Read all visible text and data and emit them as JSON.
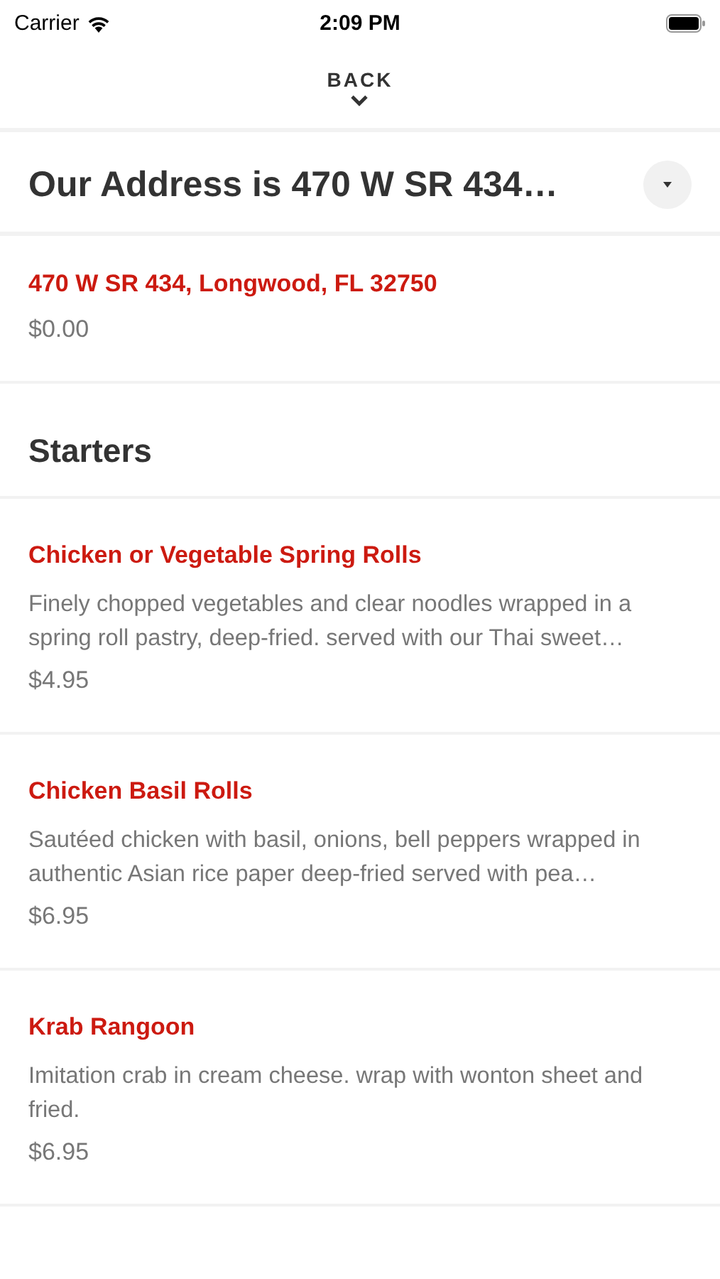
{
  "status_bar": {
    "carrier": "Carrier",
    "time": "2:09 PM"
  },
  "back": {
    "label": "BACK"
  },
  "header": {
    "title": "Our Address is 470 W SR 434…"
  },
  "location": {
    "address": "470 W SR 434, Longwood, FL 32750",
    "price": "$0.00"
  },
  "section": {
    "title": "Starters"
  },
  "items": [
    {
      "name": "Chicken or Vegetable Spring Rolls",
      "description": "Finely chopped vegetables and clear noodles wrapped in a spring roll pastry, deep-fried. served with our Thai sweet…",
      "price": "$4.95"
    },
    {
      "name": "Chicken Basil Rolls",
      "description": "Sautéed chicken with basil, onions, bell peppers wrapped in authentic Asian rice paper deep-fried served with pea…",
      "price": "$6.95"
    },
    {
      "name": "Krab Rangoon",
      "description": "Imitation crab in cream cheese. wrap with wonton sheet and fried.",
      "price": "$6.95"
    }
  ]
}
